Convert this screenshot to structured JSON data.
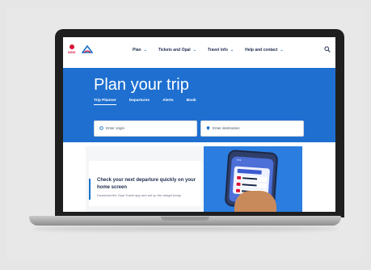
{
  "nav": {
    "logo_text": "NSW",
    "links": [
      {
        "label": "Plan"
      },
      {
        "label": "Tickets and Opal"
      },
      {
        "label": "Travel info"
      },
      {
        "label": "Help and contact"
      }
    ]
  },
  "hero": {
    "title": "Plan your trip",
    "tabs": [
      "Trip Planner",
      "Departures",
      "Alerts",
      "Book"
    ]
  },
  "inputs": {
    "origin_placeholder": "Enter origin",
    "destination_placeholder": "Enter destination"
  },
  "promo": {
    "title": "Check your next departure quickly on your home screen",
    "subtitle": "Download the Opal Travel app and set up the widget today",
    "phone_time": "9:41"
  },
  "colors": {
    "brand_blue": "#1e6fd0",
    "nsw_red": "#d7153a",
    "navy": "#1d2b4c"
  }
}
